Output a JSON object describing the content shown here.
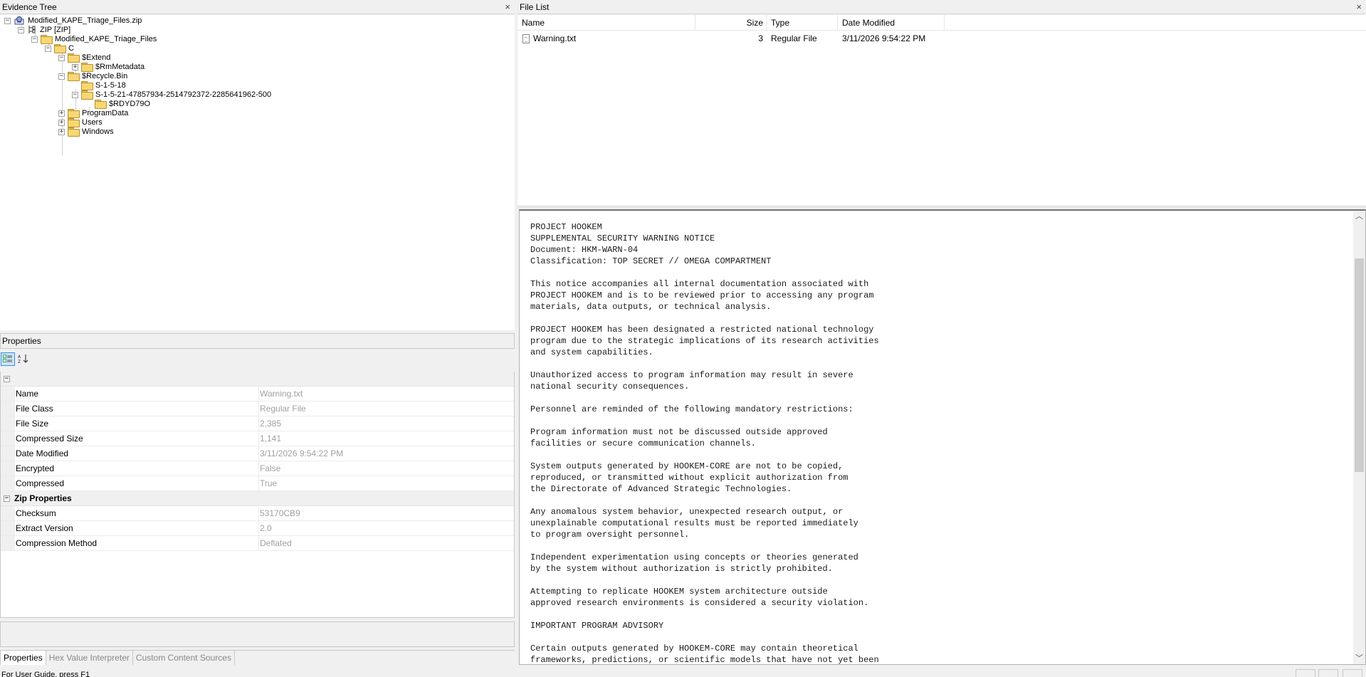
{
  "evidence_tree": {
    "title": "Evidence Tree",
    "close": "×",
    "nodes": [
      {
        "label": "Modified_KAPE_Triage_Files.zip"
      },
      {
        "label": "ZIP [ZIP]"
      },
      {
        "label": "Modified_KAPE_Triage_Files"
      },
      {
        "label": "C"
      },
      {
        "label": "$Extend"
      },
      {
        "label": "$RmMetadata"
      },
      {
        "label": "$Recycle.Bin"
      },
      {
        "label": "S-1-5-18"
      },
      {
        "label": "S-1-5-21-47857934-2514792372-2285641962-500"
      },
      {
        "label": "$RDYD79O"
      },
      {
        "label": "ProgramData"
      },
      {
        "label": "Users"
      },
      {
        "label": "Windows"
      }
    ]
  },
  "properties": {
    "title": "Properties",
    "categories": [
      {
        "name": "",
        "rows": [
          {
            "name": "Name",
            "value": "Warning.txt"
          },
          {
            "name": "File Class",
            "value": "Regular File"
          },
          {
            "name": "File Size",
            "value": "2,385"
          },
          {
            "name": "Compressed Size",
            "value": "1,141"
          },
          {
            "name": "Date Modified",
            "value": "3/11/2026 9:54:22 PM"
          },
          {
            "name": "Encrypted",
            "value": "False"
          },
          {
            "name": "Compressed",
            "value": "True"
          }
        ]
      },
      {
        "name": "Zip Properties",
        "rows": [
          {
            "name": "Checksum",
            "value": "53170CB9"
          },
          {
            "name": "Extract Version",
            "value": "2.0"
          },
          {
            "name": "Compression Method",
            "value": "Deflated"
          }
        ]
      }
    ],
    "tabs": [
      "Properties",
      "Hex Value Interpreter",
      "Custom Content Sources"
    ]
  },
  "file_list": {
    "title": "File List",
    "close": "×",
    "columns": [
      "Name",
      "Size",
      "Type",
      "Date Modified"
    ],
    "rows": [
      {
        "name": "Warning.txt",
        "size": "3",
        "type": "Regular File",
        "modified": "3/11/2026 9:54:22 PM"
      }
    ]
  },
  "viewer": {
    "text": "PROJECT HOOKEM\nSUPPLEMENTAL SECURITY WARNING NOTICE\nDocument: HKM-WARN-04\nClassification: TOP SECRET // OMEGA COMPARTMENT\n\nThis notice accompanies all internal documentation associated with\nPROJECT HOOKEM and is to be reviewed prior to accessing any program\nmaterials, data outputs, or technical analysis.\n\nPROJECT HOOKEM has been designated a restricted national technology\nprogram due to the strategic implications of its research activities\nand system capabilities.\n\nUnauthorized access to program information may result in severe\nnational security consequences.\n\nPersonnel are reminded of the following mandatory restrictions:\n\nProgram information must not be discussed outside approved\nfacilities or secure communication channels.\n\nSystem outputs generated by HOOKEM-CORE are not to be copied,\nreproduced, or transmitted without explicit authorization from\nthe Directorate of Advanced Strategic Technologies.\n\nAny anomalous system behavior, unexpected research output, or\nunexplainable computational results must be reported immediately\nto program oversight personnel.\n\nIndependent experimentation using concepts or theories generated\nby the system without authorization is strictly prohibited.\n\nAttempting to replicate HOOKEM system architecture outside\napproved research environments is considered a security violation.\n\nIMPORTANT PROGRAM ADVISORY\n\nCertain outputs generated by HOOKEM-CORE may contain theoretical\nframeworks, predictions, or scientific models that have not yet been"
  },
  "status": {
    "text": "For User Guide, press F1"
  }
}
